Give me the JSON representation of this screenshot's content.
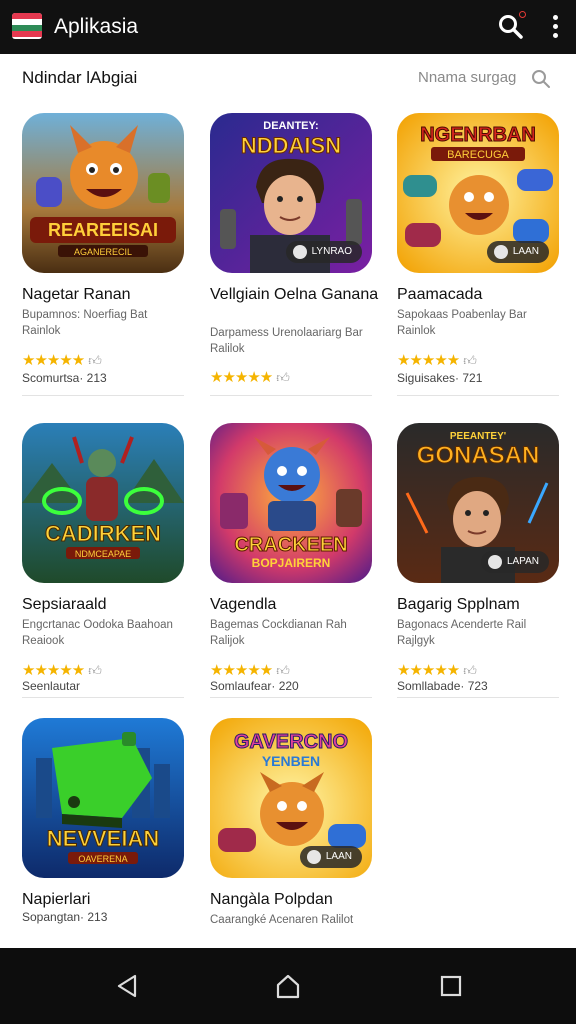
{
  "topbar": {
    "title": "Aplikasia",
    "logo_colors": [
      "#e53950",
      "#ffffff",
      "#2e8b57",
      "#ffffff"
    ],
    "icons": [
      "search-icon",
      "notification-dot",
      "more-vertical-icon"
    ]
  },
  "section": {
    "title": "Ndindar lAbgiai",
    "search_placeholder": "Nnama surgag"
  },
  "cards": [
    {
      "name": "Nagetar Ranan",
      "desc": "Bupamnos: Noerfiag Bat Rainlok",
      "stars": "★★★★★",
      "meta": "Scomurtsa· 213",
      "thumb_text": "REAREEISAI",
      "thumb_sub": "AGANERECIL",
      "badge": ""
    },
    {
      "name": "Vellgiain Oelna Ganana",
      "desc": "Darpamess Urenolaariarg Bar Ralilok",
      "stars": "★★★★★",
      "meta": "",
      "thumb_text": "NDDAISN",
      "thumb_sub": "DEANTEY:",
      "badge": "LYNRAO"
    },
    {
      "name": "Paamacada",
      "desc": "Sapokaas Poabenlay Bar Rainlok",
      "stars": "★★★★★",
      "meta": "Siguisakes· 721",
      "thumb_text": "NGENRBAN",
      "thumb_sub": "BARECUGA",
      "badge": "LAAN"
    },
    {
      "name": "Sepsiaraald",
      "desc": "Engcrtanac Oodoka Baahoan Reaiook",
      "stars": "★★★★★",
      "meta": "Seenlautar",
      "thumb_text": "CADIRKEN",
      "thumb_sub": "NDMCEAPAE",
      "badge": ""
    },
    {
      "name": "Vagendla",
      "desc": "Bagemas Cockdianan Rah Ralijok",
      "stars": "★★★★★",
      "meta": "Somlaufear· 220",
      "thumb_text": "CRACKEEN",
      "thumb_sub": "BOPJAIRERN",
      "badge": ""
    },
    {
      "name": "Bagarig Spplnam",
      "desc": "Bagonacs Acenderte Rail Rajlgyk",
      "stars": "★★★★★",
      "meta": "Somllabade· 723",
      "thumb_text": "GONASAN",
      "thumb_sub": "PEEANTEY'",
      "badge": "LAPAN"
    },
    {
      "name": "Napierlari",
      "desc": "",
      "stars": "",
      "meta": "Sopangtan· 213",
      "thumb_text": "NEVVEIAN",
      "thumb_sub": "OAVERENA",
      "badge": ""
    },
    {
      "name": "Nangàla Polpdan",
      "desc": "Caarangké Acenaren Ralilot",
      "stars": "",
      "meta": "",
      "thumb_text": "GAVERCNO",
      "thumb_sub": "YENBEN",
      "badge": "LAAN"
    }
  ],
  "navbar": {
    "buttons": [
      "back-icon",
      "home-icon",
      "recents-icon"
    ]
  }
}
